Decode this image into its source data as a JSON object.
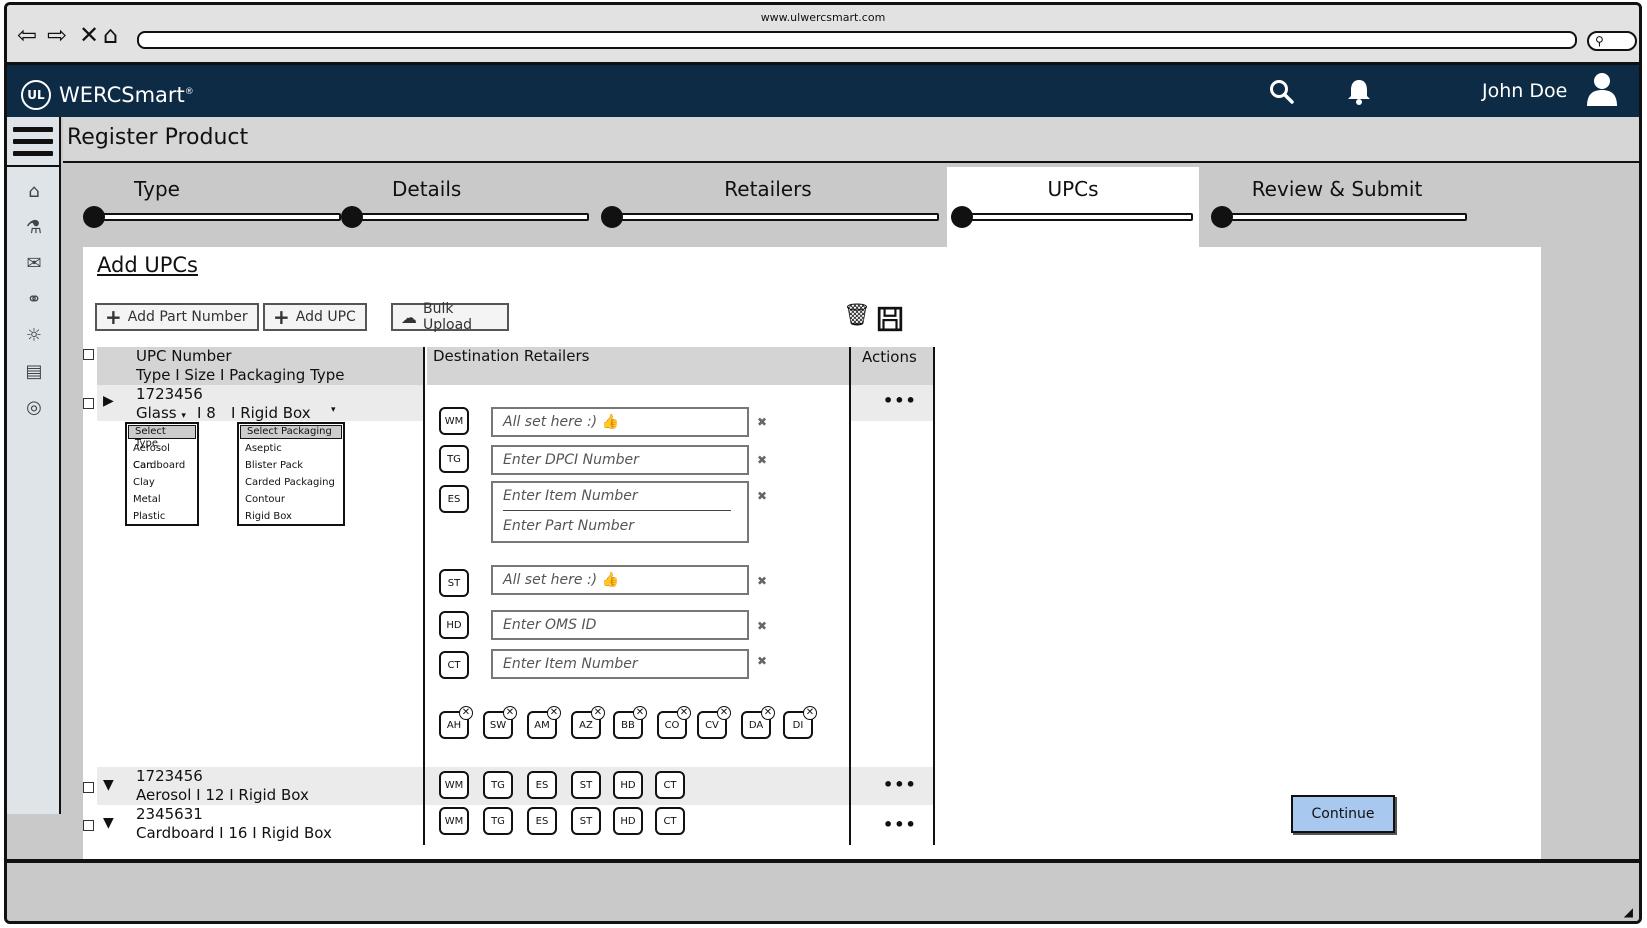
{
  "browser": {
    "url": "www.ulwercsmart.com",
    "back_icon": "arrow-left-icon",
    "forward_icon": "arrow-right-icon",
    "close_icon": "x-icon",
    "home_icon": "home-icon"
  },
  "app": {
    "logo_mark": "UL",
    "logo_name": "WERCSmart",
    "user_name": "John Doe",
    "brand_color": "#0d2b45"
  },
  "sidebar": {
    "icons": [
      "home-icon",
      "flask-icon",
      "mail-icon",
      "handshake-icon",
      "lightbulb-icon",
      "cart-icon",
      "lifebuoy-icon"
    ]
  },
  "page": {
    "title": "Register Product"
  },
  "steps": [
    {
      "label": "Type"
    },
    {
      "label": "Details"
    },
    {
      "label": "Retailers"
    },
    {
      "label": "UPCs"
    },
    {
      "label": "Review & Submit"
    }
  ],
  "panel": {
    "title": "Add UPCs",
    "add_part_label": "Add Part Number",
    "add_upc_label": "Add UPC",
    "bulk_upload_label": "Bulk Upload"
  },
  "grid": {
    "col_upc": "UPC Number",
    "col_upc_sub": "Type I Size I Packaging Type",
    "col_dest": "Destination Retailers",
    "col_actions": "Actions",
    "rows": [
      {
        "upc": "1723456",
        "type": "Glass",
        "size": "I 8",
        "packaging": "I Rigid Box",
        "type_options": [
          "Select Type",
          "Aerosol Can",
          "Cardboard",
          "Clay",
          "Metal",
          "Plastic"
        ],
        "pack_options": [
          "Select Packaging",
          "Aseptic",
          "Blister Pack",
          "Carded Packaging",
          "Contour",
          "Rigid Box"
        ],
        "retailers": [
          {
            "code": "WM",
            "placeholder": "All set here :)"
          },
          {
            "code": "TG",
            "placeholder": "Enter DPCI Number"
          },
          {
            "code": "ES",
            "placeholder": "Enter Item Number",
            "placeholder2": "Enter Part Number"
          },
          {
            "code": "ST",
            "placeholder": "All set here :)"
          },
          {
            "code": "HD",
            "placeholder": "Enter OMS ID"
          },
          {
            "code": "CT",
            "placeholder": "Enter Item Number"
          }
        ],
        "extra_retailers": [
          "AH",
          "SW",
          "AM",
          "AZ",
          "BB",
          "CO",
          "CV",
          "DA",
          "DI"
        ],
        "actions": "•••"
      },
      {
        "upc": "1723456",
        "detail": "Aerosol I 12 I Rigid Box",
        "retailers": [
          "WM",
          "TG",
          "ES",
          "ST",
          "HD",
          "CT"
        ],
        "actions": "•••"
      },
      {
        "upc": "2345631",
        "detail": "Cardboard I 16 I Rigid Box",
        "retailers": [
          "WM",
          "TG",
          "ES",
          "ST",
          "HD",
          "CT"
        ],
        "actions": "•••"
      }
    ]
  },
  "continue_label": "Continue",
  "accent_color": "#a9c8f0"
}
